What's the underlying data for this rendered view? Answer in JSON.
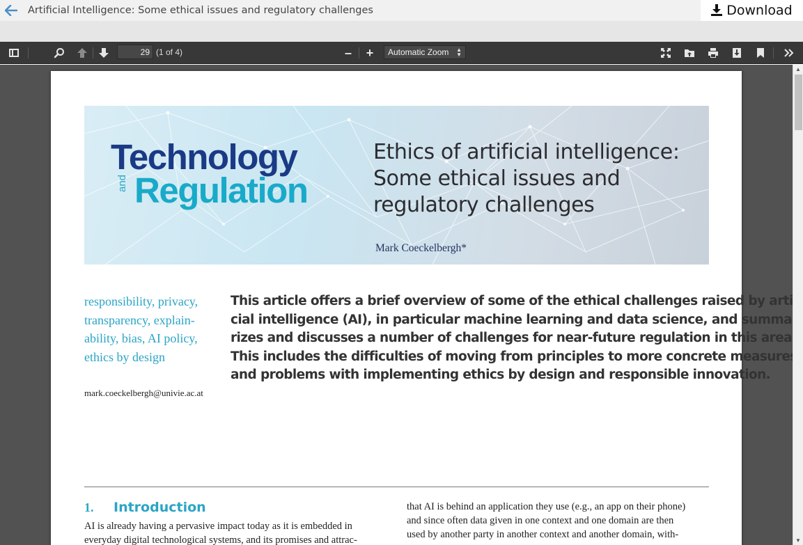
{
  "header": {
    "title": "Artificial Intelligence: Some ethical issues and regulatory challenges",
    "download_label": "Download"
  },
  "toolbar": {
    "page_number": "29",
    "page_count": "(1 of 4)",
    "zoom": "Automatic Zoom",
    "zoom_in": "+",
    "zoom_out": "–"
  },
  "document": {
    "logo_line1": "Technology",
    "logo_and": "and",
    "logo_line2": "Regulation",
    "title_lines": [
      "Ethics of artificial intelligence:",
      "Some ethical issues and",
      "regulatory challenges"
    ],
    "author": "Mark Coeckelbergh*",
    "keywords_lines": [
      "responsibility, privacy,",
      "transparency, explain-",
      "ability, bias, AI policy,",
      "ethics by design"
    ],
    "email": "mark.coeckelbergh@univie.ac.at",
    "abstract_lines": [
      "This article offers a brief overview of some of the ethical challenges raised by artifi-",
      "cial intelligence (AI), in particular machine learning and data science, and summa-",
      "rizes and discusses a number of challenges for near-future regulation in this area.",
      "This includes the difficulties of moving from principles to more concrete measures",
      "and problems with implementing ethics by design and responsible innovation."
    ],
    "section_number": "1.",
    "section_title": "Introduction",
    "left_col_lines": [
      "AI is already having a pervasive impact today as it is embedded in",
      "everyday digital technological systems, and its promises and attrac-"
    ],
    "right_col_lines": [
      "that AI is behind an application they use (e.g., an app on their phone)",
      "and since often data given in one context and one domain are then",
      "used by another party in another context and another domain, with-"
    ]
  }
}
